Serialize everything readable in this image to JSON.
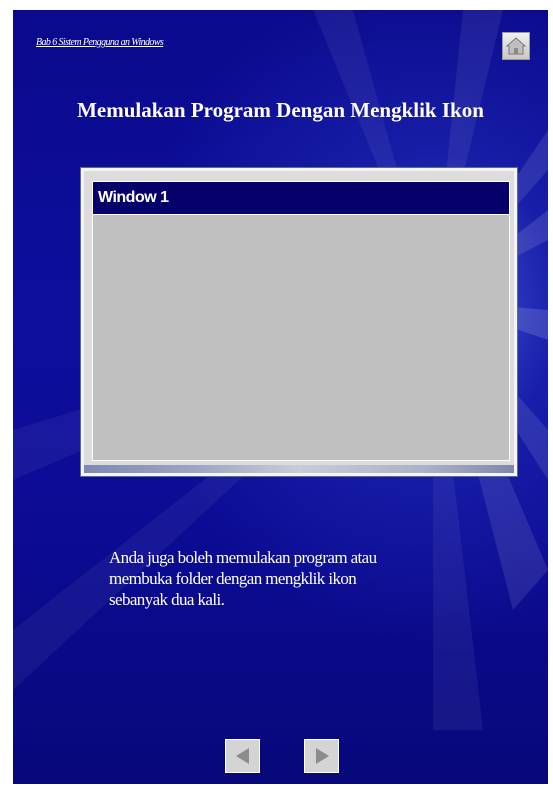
{
  "header": {
    "breadcrumb": "Bab 6 Sistem Pengguna an Windows"
  },
  "title": "Memulakan Program Dengan Mengklik Ikon",
  "window": {
    "title": "Window 1"
  },
  "body_lines": [
    "Anda juga boleh memulakan program atau",
    "membuka folder dengan mengklik ikon",
    "sebanyak dua kali."
  ],
  "icons": {
    "home": "home-icon",
    "prev": "arrow-left-icon",
    "next": "arrow-right-icon"
  },
  "colors": {
    "background": "#0b0b92",
    "window_titlebar": "#05006a",
    "window_body": "#c0c0c0"
  }
}
